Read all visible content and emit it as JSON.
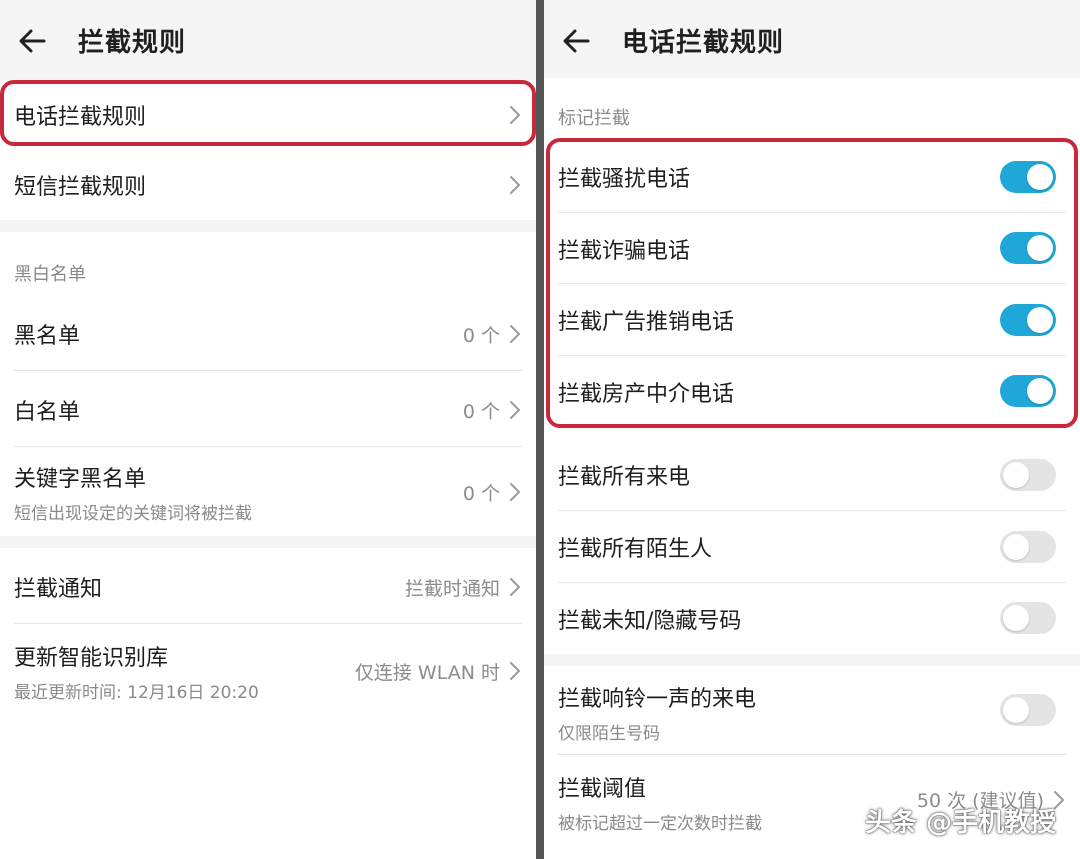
{
  "left": {
    "title": "拦截规则",
    "rows_top": [
      {
        "label": "电话拦截规则"
      },
      {
        "label": "短信拦截规则"
      }
    ],
    "list_section": "黑白名单",
    "list_rows": [
      {
        "label": "黑名单",
        "value": "0 个"
      },
      {
        "label": "白名单",
        "value": "0 个"
      },
      {
        "label": "关键字黑名单",
        "sub": "短信出现设定的关键词将被拦截",
        "value": "0 个"
      }
    ],
    "bottom_rows": [
      {
        "label": "拦截通知",
        "value": "拦截时通知"
      },
      {
        "label": "更新智能识别库",
        "sub": "最近更新时间: 12月16日 20:20",
        "value": "仅连接 WLAN 时"
      }
    ]
  },
  "right": {
    "title": "电话拦截规则",
    "section": "标记拦截",
    "marked_rows": [
      {
        "label": "拦截骚扰电话",
        "on": true
      },
      {
        "label": "拦截诈骗电话",
        "on": true
      },
      {
        "label": "拦截广告推销电话",
        "on": true
      },
      {
        "label": "拦截房产中介电话",
        "on": true
      }
    ],
    "all_rows": [
      {
        "label": "拦截所有来电",
        "on": false
      },
      {
        "label": "拦截所有陌生人",
        "on": false
      },
      {
        "label": "拦截未知/隐藏号码",
        "on": false
      }
    ],
    "ring_row": {
      "label": "拦截响铃一声的来电",
      "sub": "仅限陌生号码",
      "on": false
    },
    "threshold_row": {
      "label": "拦截阈值",
      "sub": "被标记超过一定次数时拦截",
      "value": "50 次 (建议值)"
    }
  },
  "watermark": "头条 @手机教授",
  "colors": {
    "toggle_on": "#1fa7d8",
    "toggle_off": "#e4e4e4",
    "highlight": "#c8283a"
  }
}
